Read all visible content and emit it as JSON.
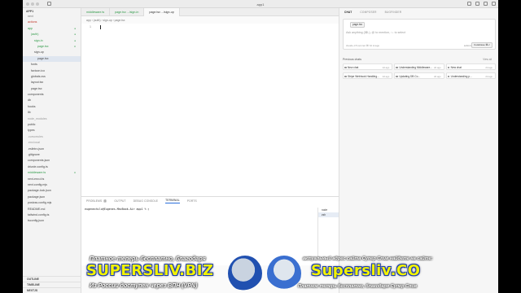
{
  "window": {
    "title": "app1"
  },
  "sidebar": {
    "project": "APP1",
    "items": [
      {
        "label": "next",
        "color": "#777",
        "indent": 1
      },
      {
        "label": "actions",
        "color": "#c0392b",
        "indent": 1
      },
      {
        "label": "app",
        "color": "#2e9a47",
        "indent": 1,
        "badge": "●"
      },
      {
        "label": "(auth)",
        "color": "#2e9a47",
        "indent": 2,
        "badge": "●"
      },
      {
        "label": "sign-in",
        "color": "#2e9a47",
        "indent": 3,
        "badge": "●"
      },
      {
        "label": "page.tsx",
        "color": "#2e9a47",
        "indent": 4,
        "badge": "U"
      },
      {
        "label": "sign-up",
        "color": "#444",
        "indent": 3
      },
      {
        "label": "page.tsx",
        "color": "#444",
        "indent": 4,
        "selected": true
      },
      {
        "label": "fonts",
        "color": "#444",
        "indent": 2
      },
      {
        "label": "favicon.ico",
        "color": "#444",
        "indent": 2
      },
      {
        "label": "globals.css",
        "color": "#444",
        "indent": 2
      },
      {
        "label": "layout.tsx",
        "color": "#444",
        "indent": 2
      },
      {
        "label": "page.tsx",
        "color": "#444",
        "indent": 2
      },
      {
        "label": "components",
        "color": "#444",
        "indent": 1
      },
      {
        "label": "db",
        "color": "#444",
        "indent": 1
      },
      {
        "label": "hooks",
        "color": "#444",
        "indent": 1
      },
      {
        "label": "lib",
        "color": "#444",
        "indent": 1
      },
      {
        "label": "node_modules",
        "color": "#999",
        "indent": 1
      },
      {
        "label": "public",
        "color": "#444",
        "indent": 1
      },
      {
        "label": "types",
        "color": "#444",
        "indent": 1
      },
      {
        "label": ".cursorrules",
        "color": "#999",
        "indent": 1
      },
      {
        "label": ".env.local",
        "color": "#999",
        "indent": 1
      },
      {
        "label": ".eslintrc.json",
        "color": "#444",
        "indent": 1
      },
      {
        "label": ".gitignore",
        "color": "#444",
        "indent": 1
      },
      {
        "label": "components.json",
        "color": "#444",
        "indent": 1
      },
      {
        "label": "drizzle.config.ts",
        "color": "#444",
        "indent": 1
      },
      {
        "label": "middleware.ts",
        "color": "#2e9a47",
        "indent": 1,
        "badge": "U"
      },
      {
        "label": "next-env.d.ts",
        "color": "#444",
        "indent": 1
      },
      {
        "label": "next.config.mjs",
        "color": "#444",
        "indent": 1
      },
      {
        "label": "package-lock.json",
        "color": "#444",
        "indent": 1
      },
      {
        "label": "package.json",
        "color": "#444",
        "indent": 1
      },
      {
        "label": "postcss.config.mjs",
        "color": "#444",
        "indent": 1
      },
      {
        "label": "README.md",
        "color": "#444",
        "indent": 1
      },
      {
        "label": "tailwind.config.ts",
        "color": "#444",
        "indent": 1
      },
      {
        "label": "tsconfig.json",
        "color": "#444",
        "indent": 1
      }
    ],
    "bottom": [
      "OUTLINE",
      "TIMELINE",
      "NEXTJS"
    ]
  },
  "tabs": [
    {
      "label": "middleware.ts",
      "active": false,
      "color": "#2e9a47"
    },
    {
      "label": "page.tsx  .../sign-in",
      "active": false,
      "color": "#2e9a47"
    },
    {
      "label": "page.tsx  .../sign-up",
      "active": true,
      "color": "#333"
    }
  ],
  "breadcrumb": "app  ›  (auth)  ›  sign-up  ›  page.tsx",
  "editor": {
    "line": "1"
  },
  "panel": {
    "tabs": [
      "PROBLEMS",
      "OUTPUT",
      "DEBUG CONSOLE",
      "TERMINAL",
      "PORTS"
    ],
    "active_tab": "TERMINAL",
    "problems_count": "0",
    "prompt": "eugenechilo@Eugenes-MacBook-Air app1 % ▯",
    "terminals": [
      "node",
      "zsh"
    ]
  },
  "chat": {
    "tabs": [
      "CHAT",
      "COMPOSER",
      "BUGFINDER"
    ],
    "active_tab": "CHAT",
    "context_chip": "page.tsx",
    "placeholder": "Ask anything (⌘L), @ to mention, ↑↓ to select",
    "footer": "claude-3.5-sonnet ⌘/ ⊕ image",
    "model_hint": "submit ↵",
    "submit_label": "Codebase ⌘↵",
    "previous_header": "Previous chats",
    "view_all": "View all",
    "previous": [
      {
        "title": "New chat",
        "ago": "2d ago"
      },
      {
        "title": "Understanding Middleware...",
        "ago": "2d ago"
      },
      {
        "title": "New chat",
        "ago": "2d ago"
      },
      {
        "title": "Stripe Webhook Handling...",
        "ago": "2d ago"
      },
      {
        "title": "Updating DB Co...",
        "ago": "2d ago"
      },
      {
        "title": "Understanding p...",
        "ago": "2d ago"
      }
    ]
  },
  "banner": {
    "line1_left": "Платное теперь бесплатно, благодаря",
    "big_left": "SUPERSLIV.BIZ",
    "line3_left": "Из России доступен через ВПН (VPN)",
    "line1_right": "актуальный адрес сайта Супер Слив найдете на сайте:",
    "big_right": "Supersliv.CO",
    "line3_right": "Платное теперь бесплатно, благодаря Супер Слив"
  },
  "colors": {
    "accent": "#2a6fdb",
    "git_added": "#2e9a47",
    "banner_yellow": "#f2f200"
  }
}
